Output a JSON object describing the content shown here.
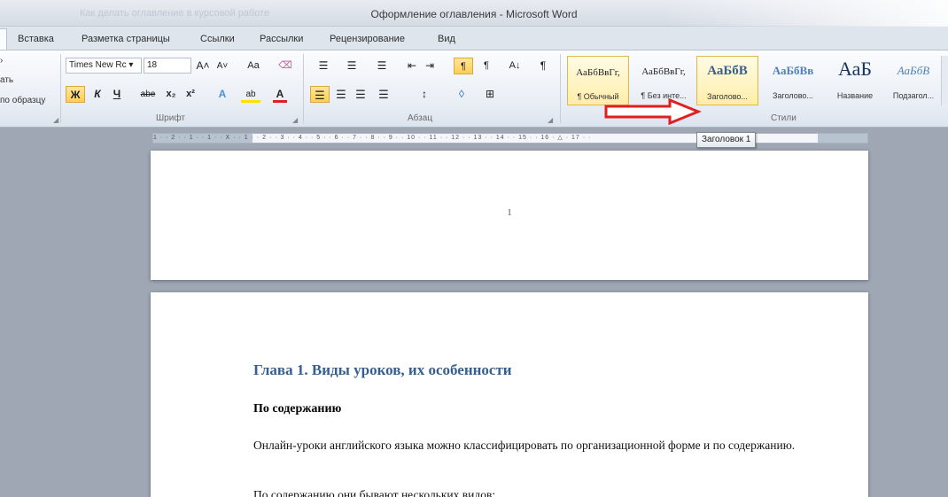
{
  "window": {
    "title": "Оформление оглавления - Microsoft Word",
    "faded_tab_text": "Как делать оглавление в курсовой работе"
  },
  "tabs": [
    "Вставка",
    "Разметка страницы",
    "Ссылки",
    "Рассылки",
    "Рецензирование",
    "Вид"
  ],
  "clipboard": {
    "line1": "›",
    "line2": "ать",
    "line3": "по образцу"
  },
  "font_group": {
    "label": "Шрифт",
    "font_name": "Times New Rc",
    "font_size": "18",
    "grow": "A˄",
    "shrink": "A˅",
    "case": "Aa",
    "clear": "⌫",
    "bold": "Ж",
    "italic": "К",
    "underline": "Ч",
    "strike": "abe",
    "subscript": "x₂",
    "superscript": "x²",
    "effects": "A",
    "highlight": "ab",
    "font_color": "A"
  },
  "paragraph_group": {
    "label": "Абзац",
    "bullets": "☰",
    "numbering": "☰",
    "multilevel": "☰",
    "outdent": "⇤",
    "indent": "⇥",
    "ltr": "¶",
    "rtl": "¶",
    "sort": "A↓",
    "pilcrow": "¶",
    "line_spacing": "↕",
    "shading": "◊",
    "borders": "⊞"
  },
  "styles_group": {
    "label": "Стили",
    "items": [
      {
        "sample": "АаБбВвГг,",
        "name": "¶ Обычный"
      },
      {
        "sample": "АаБбВвГг,",
        "name": "¶ Без инте..."
      },
      {
        "sample": "АаБбВ",
        "name": "Заголово..."
      },
      {
        "sample": "АаБбВв",
        "name": "Заголово..."
      },
      {
        "sample": "АаБ",
        "name": "Название"
      },
      {
        "sample": "АаБбВ",
        "name": "Подзагол..."
      }
    ]
  },
  "tooltip": "Заголовок 1",
  "ruler_numbers": "1 · · 2 · · 1 · · 1 · · X · · 1 · · 2 · · 3 · · 4 · · 5 · · 6 · · 7 · · 8 · · 9 · · 10 · · 11 · · 12 · · 13 · · 14 · · 15 · · 16 · △ · 17 · ·",
  "document": {
    "page_number": "1",
    "heading1": "Глава 1. Виды уроков, их особенности",
    "heading2": "По содержанию",
    "paragraph": "Онлайн-уроки английского языка можно классифицировать по организационной форме и по содержанию.",
    "paragraph2": "По содержанию они бывают нескольких видов:"
  },
  "colors": {
    "heading_blue": "#365f91",
    "arrow_red": "#e02020",
    "highlight_gold": "#ffcd56"
  }
}
